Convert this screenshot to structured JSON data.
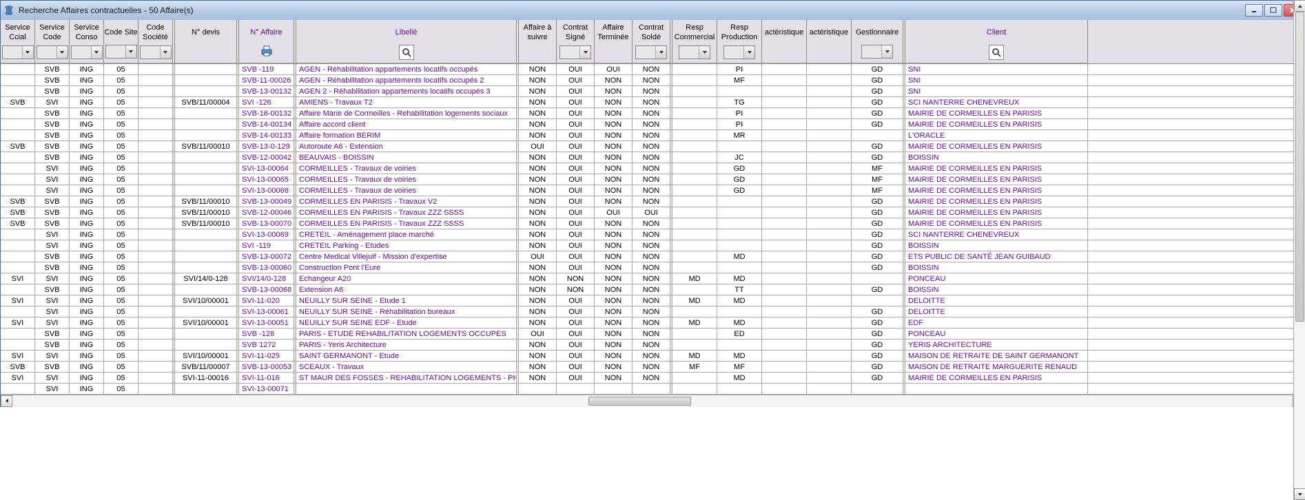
{
  "window": {
    "title": "Recherche Affaires contractuelles - 50 Affaire(s)"
  },
  "columns": {
    "service_ccial": "Service Ccial",
    "service_code": "Service Code",
    "service_conso": "Service Conso",
    "code_site": "Code Site",
    "code_societe": "Code Société",
    "n_devis": "N° devis",
    "n_affaire": "N° Affaire",
    "libelle": "Libellé",
    "affaire_suivre": "Affaire à suivre",
    "contrat_signe": "Contrat Signé",
    "affaire_terminee": "Affaire Terminée",
    "contrat_solde": "Contrat Soldé",
    "resp_commercial": "Resp Commercial",
    "resp_production": "Resp Production",
    "caracteristique1": "actéristique",
    "caracteristique2": "actéristique",
    "gestionnaire": "Gestionnaire",
    "client": "Client"
  },
  "rows": [
    {
      "sccial": "",
      "svccode": "SVB",
      "svconso": "ING",
      "codesite": "05",
      "codesoc": "",
      "devis": "",
      "affaire": "SVB -119",
      "libelle": "AGEN - Réhabilitation appartements locatifs occupés",
      "asuivre": "NON",
      "csigne": "OUI",
      "aterm": "OUI",
      "csolde": "NON",
      "rcom": "",
      "rprod": "PI",
      "car1": "",
      "car2": "",
      "gest": "GD",
      "client": "SNI"
    },
    {
      "sccial": "",
      "svccode": "SVB",
      "svconso": "ING",
      "codesite": "05",
      "codesoc": "",
      "devis": "",
      "affaire": "SVB-11-00026",
      "libelle": "AGEN - Réhabilitation appartements locatifs occupés 2",
      "asuivre": "NON",
      "csigne": "OUI",
      "aterm": "NON",
      "csolde": "NON",
      "rcom": "",
      "rprod": "MF",
      "car1": "",
      "car2": "",
      "gest": "GD",
      "client": "SNI"
    },
    {
      "sccial": "",
      "svccode": "SVB",
      "svconso": "ING",
      "codesite": "05",
      "codesoc": "",
      "devis": "",
      "affaire": "SVB-13-00132",
      "libelle": "AGEN 2 - Réhabilitation appartements locatifs occupés 3",
      "asuivre": "NON",
      "csigne": "OUI",
      "aterm": "NON",
      "csolde": "NON",
      "rcom": "",
      "rprod": "",
      "car1": "",
      "car2": "",
      "gest": "GD",
      "client": "SNI"
    },
    {
      "sccial": "SVB",
      "svccode": "SVI",
      "svconso": "ING",
      "codesite": "05",
      "codesoc": "",
      "devis": "SVB/11/00004",
      "affaire": "SVI -126",
      "libelle": "AMIENS - Travaux T2",
      "asuivre": "NON",
      "csigne": "OUI",
      "aterm": "NON",
      "csolde": "NON",
      "rcom": "",
      "rprod": "TG",
      "car1": "",
      "car2": "",
      "gest": "GD",
      "client": "SCI NANTERRE CHENEVREUX"
    },
    {
      "sccial": "",
      "svccode": "SVB",
      "svconso": "ING",
      "codesite": "05",
      "codesoc": "",
      "devis": "",
      "affaire": "SVB-16-00132",
      "libelle": "Affaire Marie de Cormeilles - Rehabilitation logements sociaux",
      "asuivre": "NON",
      "csigne": "OUI",
      "aterm": "NON",
      "csolde": "NON",
      "rcom": "",
      "rprod": "PI",
      "car1": "",
      "car2": "",
      "gest": "GD",
      "client": "MAIRIE DE CORMEILLES EN PARISIS"
    },
    {
      "sccial": "",
      "svccode": "SVB",
      "svconso": "ING",
      "codesite": "05",
      "codesoc": "",
      "devis": "",
      "affaire": "SVB-14-00134",
      "libelle": "Affaire accord client",
      "asuivre": "NON",
      "csigne": "OUI",
      "aterm": "NON",
      "csolde": "NON",
      "rcom": "",
      "rprod": "PI",
      "car1": "",
      "car2": "",
      "gest": "GD",
      "client": "MAIRIE DE CORMEILLES EN PARISIS"
    },
    {
      "sccial": "",
      "svccode": "SVB",
      "svconso": "ING",
      "codesite": "05",
      "codesoc": "",
      "devis": "",
      "affaire": "SVB-14-00133",
      "libelle": "Affaire formation BERIM",
      "asuivre": "NON",
      "csigne": "OUI",
      "aterm": "NON",
      "csolde": "NON",
      "rcom": "",
      "rprod": "MR",
      "car1": "",
      "car2": "",
      "gest": "",
      "client": "L'ORACLE"
    },
    {
      "sccial": "SVB",
      "svccode": "SVB",
      "svconso": "ING",
      "codesite": "05",
      "codesoc": "",
      "devis": "SVB/11/00010",
      "affaire": "SVB-13-0-129",
      "libelle": "Autoroute A6 - Extension",
      "asuivre": "OUI",
      "csigne": "OUI",
      "aterm": "NON",
      "csolde": "NON",
      "rcom": "",
      "rprod": "",
      "car1": "",
      "car2": "",
      "gest": "GD",
      "client": "MAIRIE DE CORMEILLES EN PARISIS"
    },
    {
      "sccial": "",
      "svccode": "SVB",
      "svconso": "ING",
      "codesite": "05",
      "codesoc": "",
      "devis": "",
      "affaire": "SVB-12-00042",
      "libelle": "BEAUVAIS - BOISSIN",
      "asuivre": "NON",
      "csigne": "OUI",
      "aterm": "NON",
      "csolde": "NON",
      "rcom": "",
      "rprod": "JC",
      "car1": "",
      "car2": "",
      "gest": "GD",
      "client": "BOISSIN"
    },
    {
      "sccial": "",
      "svccode": "SVI",
      "svconso": "ING",
      "codesite": "05",
      "codesoc": "",
      "devis": "",
      "affaire": "SVI-13-00064",
      "libelle": "CORMEILLES - Travaux de voiries",
      "asuivre": "NON",
      "csigne": "OUI",
      "aterm": "NON",
      "csolde": "NON",
      "rcom": "",
      "rprod": "GD",
      "car1": "",
      "car2": "",
      "gest": "MF",
      "client": "MAIRIE DE CORMEILLES EN PARISIS"
    },
    {
      "sccial": "",
      "svccode": "SVI",
      "svconso": "ING",
      "codesite": "05",
      "codesoc": "",
      "devis": "",
      "affaire": "SVI-13-00065",
      "libelle": "CORMEILLES - Travaux de voiries",
      "asuivre": "NON",
      "csigne": "OUI",
      "aterm": "NON",
      "csolde": "NON",
      "rcom": "",
      "rprod": "GD",
      "car1": "",
      "car2": "",
      "gest": "MF",
      "client": "MAIRIE DE CORMEILLES EN PARISIS"
    },
    {
      "sccial": "",
      "svccode": "SVI",
      "svconso": "ING",
      "codesite": "05",
      "codesoc": "",
      "devis": "",
      "affaire": "SVI-13-00066",
      "libelle": "CORMEILLES - Travaux de voiries",
      "asuivre": "NON",
      "csigne": "OUI",
      "aterm": "NON",
      "csolde": "NON",
      "rcom": "",
      "rprod": "GD",
      "car1": "",
      "car2": "",
      "gest": "MF",
      "client": "MAIRIE DE CORMEILLES EN PARISIS"
    },
    {
      "sccial": "SVB",
      "svccode": "SVB",
      "svconso": "ING",
      "codesite": "05",
      "codesoc": "",
      "devis": "SVB/11/00010",
      "affaire": "SVB-13-00049",
      "libelle": "CORMEILLES EN PARISIS - Travaux V2",
      "asuivre": "NON",
      "csigne": "OUI",
      "aterm": "NON",
      "csolde": "NON",
      "rcom": "",
      "rprod": "",
      "car1": "",
      "car2": "",
      "gest": "GD",
      "client": "MAIRIE DE CORMEILLES EN PARISIS"
    },
    {
      "sccial": "SVB",
      "svccode": "SVB",
      "svconso": "ING",
      "codesite": "05",
      "codesoc": "",
      "devis": "SVB/11/00010",
      "affaire": "SVB-12-00046",
      "libelle": "CORMEILLES EN PARISIS - Travaux ZZZ SSSS",
      "asuivre": "NON",
      "csigne": "OUI",
      "aterm": "OUI",
      "csolde": "OUI",
      "rcom": "",
      "rprod": "",
      "car1": "",
      "car2": "",
      "gest": "GD",
      "client": "MAIRIE DE CORMEILLES EN PARISIS"
    },
    {
      "sccial": "SVB",
      "svccode": "SVB",
      "svconso": "ING",
      "codesite": "05",
      "codesoc": "",
      "devis": "SVB/11/00010",
      "affaire": "SVB-13-00070",
      "libelle": "CORMEILLES EN PARISIS - Travaux ZZZ SSSS",
      "asuivre": "NON",
      "csigne": "OUI",
      "aterm": "NON",
      "csolde": "NON",
      "rcom": "",
      "rprod": "",
      "car1": "",
      "car2": "",
      "gest": "GD",
      "client": "MAIRIE DE CORMEILLES EN PARISIS"
    },
    {
      "sccial": "",
      "svccode": "SVI",
      "svconso": "ING",
      "codesite": "05",
      "codesoc": "",
      "devis": "",
      "affaire": "SVI-13-00069",
      "libelle": "CRETEIL - Aménagement place marché",
      "asuivre": "NON",
      "csigne": "OUI",
      "aterm": "NON",
      "csolde": "NON",
      "rcom": "",
      "rprod": "",
      "car1": "",
      "car2": "",
      "gest": "GD",
      "client": "SCI NANTERRE CHENEVREUX"
    },
    {
      "sccial": "",
      "svccode": "SVI",
      "svconso": "ING",
      "codesite": "05",
      "codesoc": "",
      "devis": "",
      "affaire": "SVI -119",
      "libelle": "CRETEIL Parking - Etudes",
      "asuivre": "NON",
      "csigne": "OUI",
      "aterm": "NON",
      "csolde": "NON",
      "rcom": "",
      "rprod": "",
      "car1": "",
      "car2": "",
      "gest": "GD",
      "client": "BOISSIN"
    },
    {
      "sccial": "",
      "svccode": "SVB",
      "svconso": "ING",
      "codesite": "05",
      "codesoc": "",
      "devis": "",
      "affaire": "SVB-13-00072",
      "libelle": "Centre Medical Villejuif - Mission d'expertise",
      "asuivre": "OUI",
      "csigne": "OUI",
      "aterm": "NON",
      "csolde": "NON",
      "rcom": "",
      "rprod": "MD",
      "car1": "",
      "car2": "",
      "gest": "GD",
      "client": "ETS PUBLIC DE SANTÉ JEAN GUIBAUD"
    },
    {
      "sccial": "",
      "svccode": "SVB",
      "svconso": "ING",
      "codesite": "05",
      "codesoc": "",
      "devis": "",
      "affaire": "SVB-13-00060",
      "libelle": "Construction Pont l'Eure",
      "asuivre": "NON",
      "csigne": "OUI",
      "aterm": "NON",
      "csolde": "NON",
      "rcom": "",
      "rprod": "",
      "car1": "",
      "car2": "",
      "gest": "GD",
      "client": "BOISSIN"
    },
    {
      "sccial": "SVI",
      "svccode": "SVI",
      "svconso": "ING",
      "codesite": "05",
      "codesoc": "",
      "devis": "SVI/14/0-128",
      "affaire": "SVI/14/0-128",
      "libelle": "Echangeur A20",
      "asuivre": "NON",
      "csigne": "NON",
      "aterm": "NON",
      "csolde": "NON",
      "rcom": "MD",
      "rprod": "MD",
      "car1": "",
      "car2": "",
      "gest": "",
      "client": "PONCEAU"
    },
    {
      "sccial": "",
      "svccode": "SVB",
      "svconso": "ING",
      "codesite": "05",
      "codesoc": "",
      "devis": "",
      "affaire": "SVB-13-00068",
      "libelle": "Extension A6",
      "asuivre": "NON",
      "csigne": "NON",
      "aterm": "NON",
      "csolde": "NON",
      "rcom": "",
      "rprod": "TT",
      "car1": "",
      "car2": "",
      "gest": "GD",
      "client": "BOISSIN"
    },
    {
      "sccial": "SVI",
      "svccode": "SVI",
      "svconso": "ING",
      "codesite": "05",
      "codesoc": "",
      "devis": "SVI/10/00001",
      "affaire": "SVI-11-020",
      "libelle": "NEUILLY SUR SEINE - Etude 1",
      "asuivre": "NON",
      "csigne": "OUI",
      "aterm": "NON",
      "csolde": "NON",
      "rcom": "MD",
      "rprod": "MD",
      "car1": "",
      "car2": "",
      "gest": "",
      "client": "DELOITTE"
    },
    {
      "sccial": "",
      "svccode": "SVI",
      "svconso": "ING",
      "codesite": "05",
      "codesoc": "",
      "devis": "",
      "affaire": "SVI-13-00061",
      "libelle": "NEUILLY SUR SEINE - Réhabilitation bureaux",
      "asuivre": "NON",
      "csigne": "OUI",
      "aterm": "NON",
      "csolde": "NON",
      "rcom": "",
      "rprod": "",
      "car1": "",
      "car2": "",
      "gest": "GD",
      "client": "DELOITTE"
    },
    {
      "sccial": "SVI",
      "svccode": "SVI",
      "svconso": "ING",
      "codesite": "05",
      "codesoc": "",
      "devis": "SVI/10/00001",
      "affaire": "SVI-13-00051",
      "libelle": "NEUILLY SUR SEINE EDF - Etude",
      "asuivre": "NON",
      "csigne": "OUI",
      "aterm": "NON",
      "csolde": "NON",
      "rcom": "MD",
      "rprod": "MD",
      "car1": "",
      "car2": "",
      "gest": "GD",
      "client": "EDF"
    },
    {
      "sccial": "",
      "svccode": "SVB",
      "svconso": "ING",
      "codesite": "05",
      "codesoc": "",
      "devis": "",
      "affaire": "SVB -128",
      "libelle": "PARIS - ETUDE REHABILITATION LOGEMENTS OCCUPES",
      "asuivre": "OUI",
      "csigne": "OUI",
      "aterm": "NON",
      "csolde": "NON",
      "rcom": "",
      "rprod": "ED",
      "car1": "",
      "car2": "",
      "gest": "GD",
      "client": "PONCEAU"
    },
    {
      "sccial": "",
      "svccode": "SVB",
      "svconso": "ING",
      "codesite": "05",
      "codesoc": "",
      "devis": "",
      "affaire": "SVB 1272",
      "libelle": "PARIS - Yeris Architecture",
      "asuivre": "NON",
      "csigne": "OUI",
      "aterm": "NON",
      "csolde": "NON",
      "rcom": "",
      "rprod": "",
      "car1": "",
      "car2": "",
      "gest": "GD",
      "client": "YERIS ARCHITECTURE"
    },
    {
      "sccial": "SVI",
      "svccode": "SVI",
      "svconso": "ING",
      "codesite": "05",
      "codesoc": "",
      "devis": "SVI/10/00001",
      "affaire": "SVI-11-025",
      "libelle": "SAINT GERMANONT - Etude",
      "asuivre": "NON",
      "csigne": "OUI",
      "aterm": "NON",
      "csolde": "NON",
      "rcom": "MD",
      "rprod": "MD",
      "car1": "",
      "car2": "",
      "gest": "GD",
      "client": "MAISON DE RETRAITE DE SAINT GERMANONT"
    },
    {
      "sccial": "SVB",
      "svccode": "SVB",
      "svconso": "ING",
      "codesite": "05",
      "codesoc": "",
      "devis": "SVB/11/00007",
      "affaire": "SVB-13-00053",
      "libelle": "SCEAUX - Travaux",
      "asuivre": "NON",
      "csigne": "OUI",
      "aterm": "NON",
      "csolde": "NON",
      "rcom": "MF",
      "rprod": "MF",
      "car1": "",
      "car2": "",
      "gest": "GD",
      "client": "MAISON DE RETRAITE MARGUERITE RENAUD"
    },
    {
      "sccial": "SVI",
      "svccode": "SVI",
      "svconso": "ING",
      "codesite": "05",
      "codesoc": "",
      "devis": "SVI-11-00016",
      "affaire": "SVI-11-016",
      "libelle": "ST MAUR DES FOSSES - REHABILITATION LOGEMENTS - PH",
      "asuivre": "NON",
      "csigne": "OUI",
      "aterm": "NON",
      "csolde": "NON",
      "rcom": "",
      "rprod": "MD",
      "car1": "",
      "car2": "",
      "gest": "GD",
      "client": "MAIRIE DE CORMEILLES EN PARISIS"
    },
    {
      "sccial": "",
      "svccode": "SVI",
      "svconso": "ING",
      "codesite": "05",
      "codesoc": "",
      "devis": "",
      "affaire": "SVI-13-00071",
      "libelle": "",
      "asuivre": "",
      "csigne": "",
      "aterm": "",
      "csolde": "",
      "rcom": "",
      "rprod": "",
      "car1": "",
      "car2": "",
      "gest": "",
      "client": ""
    }
  ]
}
